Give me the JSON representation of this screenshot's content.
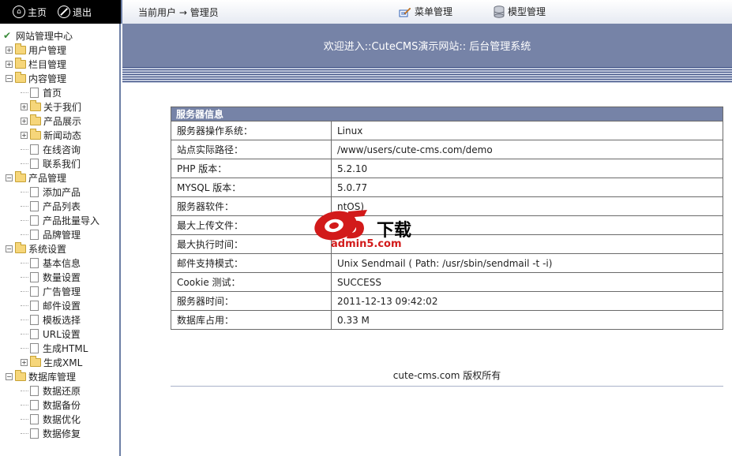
{
  "topbar": {
    "home_label": "主页",
    "logout_label": "退出",
    "current_user_label": "当前用户",
    "arrow": "→",
    "username": "管理员",
    "menu_manage_label": "菜单管理",
    "model_manage_label": "模型管理"
  },
  "sidebar": {
    "root_label": "网站管理中心",
    "items": [
      {
        "label": "用户管理",
        "level": 0,
        "type": "folder",
        "expander": "+"
      },
      {
        "label": "栏目管理",
        "level": 0,
        "type": "folder",
        "expander": "+"
      },
      {
        "label": "内容管理",
        "level": 0,
        "type": "folder",
        "expander": "-"
      },
      {
        "label": "首页",
        "level": 1,
        "type": "page"
      },
      {
        "label": "关于我们",
        "level": 1,
        "type": "folder",
        "expander": "+"
      },
      {
        "label": "产品展示",
        "level": 1,
        "type": "folder",
        "expander": "+"
      },
      {
        "label": "新闻动态",
        "level": 1,
        "type": "folder",
        "expander": "+"
      },
      {
        "label": "在线咨询",
        "level": 1,
        "type": "page"
      },
      {
        "label": "联系我们",
        "level": 1,
        "type": "page"
      },
      {
        "label": "产品管理",
        "level": 0,
        "type": "folder",
        "expander": "-"
      },
      {
        "label": "添加产品",
        "level": 1,
        "type": "page"
      },
      {
        "label": "产品列表",
        "level": 1,
        "type": "page"
      },
      {
        "label": "产品批量导入",
        "level": 1,
        "type": "page"
      },
      {
        "label": "品牌管理",
        "level": 1,
        "type": "page"
      },
      {
        "label": "系统设置",
        "level": 0,
        "type": "folder",
        "expander": "-"
      },
      {
        "label": "基本信息",
        "level": 1,
        "type": "page"
      },
      {
        "label": "数量设置",
        "level": 1,
        "type": "page"
      },
      {
        "label": "广告管理",
        "level": 1,
        "type": "page"
      },
      {
        "label": "邮件设置",
        "level": 1,
        "type": "page"
      },
      {
        "label": "模板选择",
        "level": 1,
        "type": "page"
      },
      {
        "label": "URL设置",
        "level": 1,
        "type": "page"
      },
      {
        "label": "生成HTML",
        "level": 1,
        "type": "page"
      },
      {
        "label": "生成XML",
        "level": 1,
        "type": "folder",
        "expander": "+"
      },
      {
        "label": "数据库管理",
        "level": 0,
        "type": "folder",
        "expander": "-"
      },
      {
        "label": "数据还原",
        "level": 1,
        "type": "page"
      },
      {
        "label": "数据备份",
        "level": 1,
        "type": "page"
      },
      {
        "label": "数据优化",
        "level": 1,
        "type": "page"
      },
      {
        "label": "数据修复",
        "level": 1,
        "type": "page"
      }
    ]
  },
  "banner": {
    "welcome": "欢迎进入::CuteCMS演示网站:: 后台管理系统"
  },
  "server_info": {
    "title": "服务器信息",
    "rows": [
      {
        "key": "服务器操作系统：",
        "value": "Linux"
      },
      {
        "key": "站点实际路径：",
        "value": "/www/users/cute-cms.com/demo"
      },
      {
        "key": "PHP 版本：",
        "value": "5.2.10"
      },
      {
        "key": "MYSQL 版本：",
        "value": "5.0.77"
      },
      {
        "key": "服务器软件：",
        "value": "ntOS)"
      },
      {
        "key": "最大上传文件：",
        "value": ""
      },
      {
        "key": "最大执行时间：",
        "value": ""
      },
      {
        "key": "邮件支持模式：",
        "value": "Unix Sendmail ( Path: /usr/sbin/sendmail -t -i)"
      },
      {
        "key": "Cookie 测试：",
        "value": "SUCCESS"
      },
      {
        "key": "服务器时间：",
        "value": "2011-12-13 09:42:02"
      },
      {
        "key": "数据库占用：",
        "value": "0.33 M"
      }
    ]
  },
  "footer": {
    "copyright": "cute-cms.com 版权所有"
  },
  "watermark": {
    "logo": "a5",
    "text": "下载",
    "url": "admin5.com"
  },
  "colors": {
    "header_blue": "#7683a7",
    "stripe_dark": "#3f5185",
    "watermark_red": "#d21a1a"
  }
}
